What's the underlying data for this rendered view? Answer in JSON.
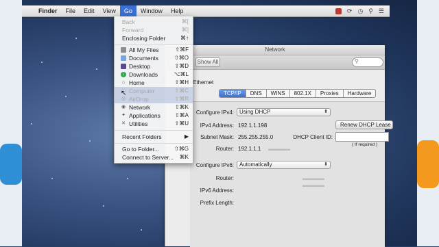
{
  "menubar": {
    "apple_glyph": "",
    "items": [
      "Finder",
      "File",
      "Edit",
      "View",
      "Go",
      "Window",
      "Help"
    ]
  },
  "go_menu": {
    "items": [
      {
        "label": "Back",
        "shortcut": "⌘[",
        "disabled": true
      },
      {
        "label": "Forward",
        "shortcut": "⌘]",
        "disabled": true
      },
      {
        "label": "Enclosing Folder",
        "shortcut": "⌘↑"
      },
      {
        "label": "All My Files",
        "shortcut": "⇧⌘F",
        "icon": "all-files-icon"
      },
      {
        "label": "Documents",
        "shortcut": "⇧⌘O",
        "icon": "documents-folder-icon"
      },
      {
        "label": "Desktop",
        "shortcut": "⇧⌘D",
        "icon": "desktop-icon"
      },
      {
        "label": "Downloads",
        "shortcut": "⌥⌘L",
        "icon": "downloads-icon"
      },
      {
        "label": "Home",
        "shortcut": "⇧⌘H",
        "icon": "home-icon"
      },
      {
        "label": "Computer",
        "shortcut": "⇧⌘C",
        "icon": "computer-icon",
        "disabled": true
      },
      {
        "label": "AirDrop",
        "shortcut": "⇧⌘R",
        "icon": "airdrop-icon",
        "disabled": true
      },
      {
        "label": "Network",
        "shortcut": "⇧⌘K",
        "icon": "network-icon"
      },
      {
        "label": "Applications",
        "shortcut": "⇧⌘A",
        "icon": "applications-icon"
      },
      {
        "label": "Utilities",
        "shortcut": "⇧⌘U",
        "icon": "utilities-icon"
      },
      {
        "label": "Recent Folders",
        "shortcut": "▶"
      },
      {
        "label": "Go to Folder...",
        "shortcut": "⇧⌘G"
      },
      {
        "label": "Connect to Server...",
        "shortcut": "⌘K"
      }
    ]
  },
  "network_window": {
    "title": "Network",
    "show_all": "Show All",
    "section_label": "Ethernet",
    "tabs": [
      "TCP/IP",
      "DNS",
      "WINS",
      "802.1X",
      "Proxies",
      "Hardware"
    ],
    "selected_tab": "TCP/IP",
    "configure_ipv4_label": "Configure IPv4:",
    "configure_ipv4_value": "Using DHCP",
    "ipv4_label": "IPv4 Address:",
    "ipv4_value": "192.1.1.198",
    "subnet_label": "Subnet Mask:",
    "subnet_value": "255.255.255.0",
    "router_label": "Router:",
    "router_value": "192.1.1.1",
    "renew_button": "Renew DHCP Lease",
    "dhcp_client_label": "DHCP Client ID:",
    "dhcp_client_hint": "( If required )",
    "configure_ipv6_label": "Configure IPv6:",
    "configure_ipv6_value": "Automatically",
    "router6_label": "Router:",
    "ipv6_label": "IPv6 Address:",
    "prefix_label": "Prefix Length:"
  }
}
